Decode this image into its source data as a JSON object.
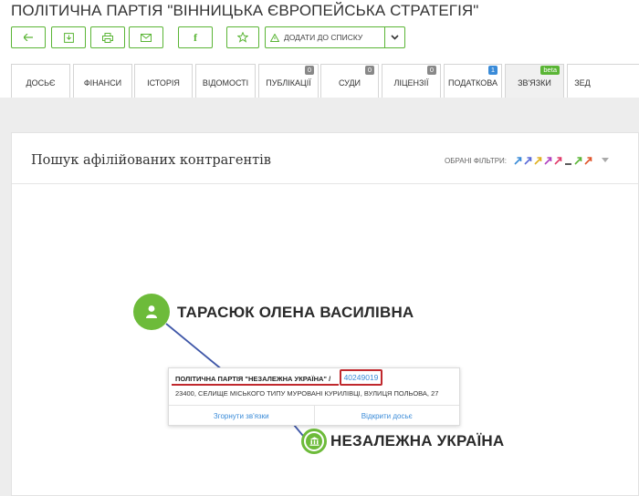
{
  "page": {
    "title": "ПОЛІТИЧНА ПАРТІЯ \"ВІННИЦЬКА ЄВРОПЕЙСЬКА СТРАТЕГІЯ\""
  },
  "toolbar": {
    "buttons": [
      {
        "icon": "arrow-left-icon"
      },
      {
        "icon": "download-icon"
      },
      {
        "icon": "print-icon"
      },
      {
        "icon": "mail-icon"
      },
      {
        "icon": "facebook-icon",
        "glyph": "f"
      },
      {
        "icon": "star-icon"
      }
    ],
    "add_to_list_label": "ДОДАТИ ДО СПИСКУ",
    "accent_color": "#5ab535"
  },
  "tabs": [
    {
      "label": "ДОСЬЄ"
    },
    {
      "label": "ФІНАНСИ"
    },
    {
      "label": "ІСТОРІЯ"
    },
    {
      "label": "ВІДОМОСТІ"
    },
    {
      "label": "ПУБЛІКАЦІЇ",
      "badge": "0"
    },
    {
      "label": "СУДИ",
      "badge": "0"
    },
    {
      "label": "ЛІЦЕНЗІЇ",
      "badge": "0"
    },
    {
      "label": "ПОДАТКОВА",
      "badge": "1"
    },
    {
      "label": "ЗВ'ЯЗКИ",
      "badge": "beta",
      "active": true
    },
    {
      "label": "ЗЕД"
    }
  ],
  "panel": {
    "title": "Пошук афілійованих контрагентів",
    "filters_label": "ОБРАНІ ФІЛЬТРИ:",
    "filter_colors": [
      "#3a8bd8",
      "#5a6ad8",
      "#e0b020",
      "#b040c0",
      "#e03a6a",
      "#333333",
      "#5ab535",
      "#e0542a"
    ]
  },
  "graph": {
    "person_name": "ТАРАСЮК ОЛЕНА ВАСИЛІВНА",
    "org_name": "НЕЗАЛЕЖНА УКРАЇНА",
    "popup": {
      "org_full": "ПОЛІТИЧНА ПАРТІЯ \"НЕЗАЛЕЖНА УКРАЇНА\" /",
      "edrpou": "40249019",
      "address": "23400, СЕЛИЩЕ МІСЬКОГО ТИПУ МУРОВАНІ КУРИЛІВЦІ, ВУЛИЦЯ ПОЛЬОВА, 27",
      "collapse_label": "Згорнути зв'язки",
      "open_label": "Відкрити досьє"
    }
  }
}
